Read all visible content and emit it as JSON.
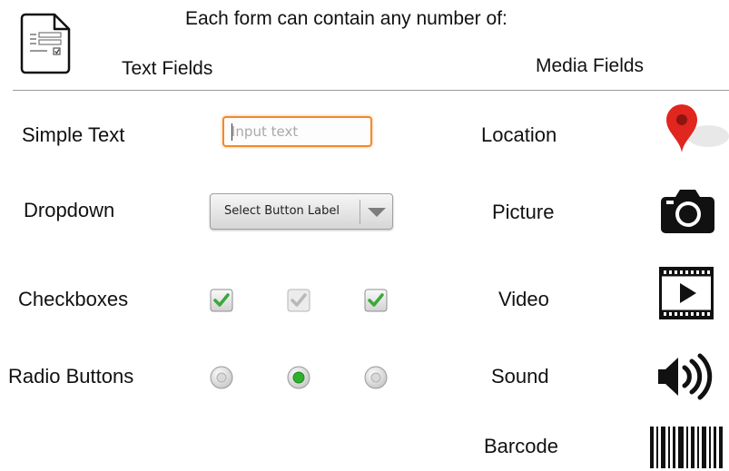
{
  "header": {
    "title": "Each form can contain any number of:",
    "text_fields_heading": "Text Fields",
    "media_fields_heading": "Media Fields",
    "form_icon": "form-document-icon"
  },
  "text_fields": {
    "simple_text": {
      "label": "Simple Text",
      "placeholder": "Input text"
    },
    "dropdown": {
      "label": "Dropdown",
      "selected": "Select Button Label",
      "icon": "chevron-down-icon"
    },
    "checkboxes": {
      "label": "Checkboxes",
      "items": [
        {
          "state": "checked"
        },
        {
          "state": "checked-disabled"
        },
        {
          "state": "checked"
        }
      ]
    },
    "radio_buttons": {
      "label": "Radio Buttons",
      "items": [
        {
          "selected": false
        },
        {
          "selected": true
        },
        {
          "selected": false
        }
      ]
    }
  },
  "media_fields": {
    "location": {
      "label": "Location",
      "icon": "map-pin-icon"
    },
    "picture": {
      "label": "Picture",
      "icon": "camera-icon"
    },
    "video": {
      "label": "Video",
      "icon": "film-icon"
    },
    "sound": {
      "label": "Sound",
      "icon": "speaker-icon"
    },
    "barcode": {
      "label": "Barcode",
      "icon": "barcode-icon"
    }
  },
  "colors": {
    "accent_orange": "#f08a2a",
    "check_green": "#3aa83a",
    "radio_green": "#2fae2f",
    "pin_red": "#e0261f",
    "divider": "#9a9a9a"
  }
}
